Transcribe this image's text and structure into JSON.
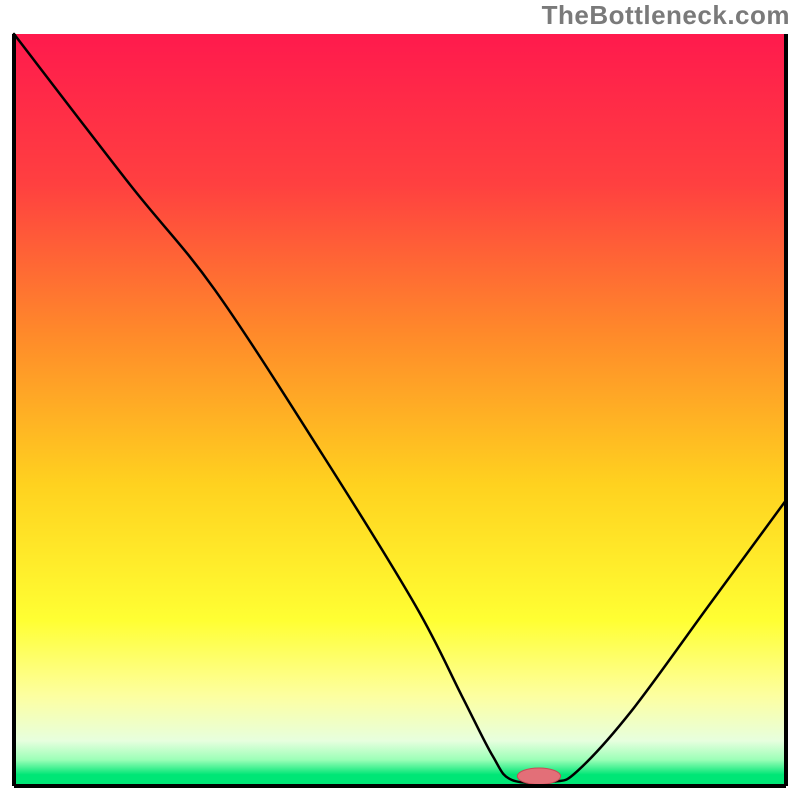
{
  "watermark": "TheBottleneck.com",
  "chart_data": {
    "type": "line",
    "title": "",
    "xlabel": "",
    "ylabel": "",
    "xlim": [
      0,
      100
    ],
    "ylim": [
      0,
      100
    ],
    "gradient_stops": [
      {
        "offset": 0.0,
        "color": "#ff1a4d"
      },
      {
        "offset": 0.2,
        "color": "#ff4040"
      },
      {
        "offset": 0.4,
        "color": "#ff8a2a"
      },
      {
        "offset": 0.6,
        "color": "#ffd21f"
      },
      {
        "offset": 0.78,
        "color": "#ffff33"
      },
      {
        "offset": 0.88,
        "color": "#fdffa0"
      },
      {
        "offset": 0.94,
        "color": "#e7ffde"
      },
      {
        "offset": 0.965,
        "color": "#9cffb8"
      },
      {
        "offset": 0.985,
        "color": "#00e676"
      },
      {
        "offset": 1.0,
        "color": "#00e676"
      }
    ],
    "axis_color": "#000000",
    "curve": {
      "color": "#000000",
      "width": 2.5,
      "points": [
        {
          "x": 0.0,
          "y": 100.0
        },
        {
          "x": 15.0,
          "y": 80.0
        },
        {
          "x": 26.0,
          "y": 66.0
        },
        {
          "x": 40.0,
          "y": 44.0
        },
        {
          "x": 52.0,
          "y": 24.0
        },
        {
          "x": 58.0,
          "y": 12.0
        },
        {
          "x": 62.0,
          "y": 4.0
        },
        {
          "x": 64.5,
          "y": 0.8
        },
        {
          "x": 70.0,
          "y": 0.6
        },
        {
          "x": 73.0,
          "y": 2.0
        },
        {
          "x": 80.0,
          "y": 10.0
        },
        {
          "x": 90.0,
          "y": 24.0
        },
        {
          "x": 100.0,
          "y": 38.0
        }
      ]
    },
    "marker": {
      "x": 68.0,
      "y": 1.3,
      "rx": 2.8,
      "ry": 1.1,
      "fill": "#e36f78",
      "stroke": "#c94a55"
    }
  }
}
